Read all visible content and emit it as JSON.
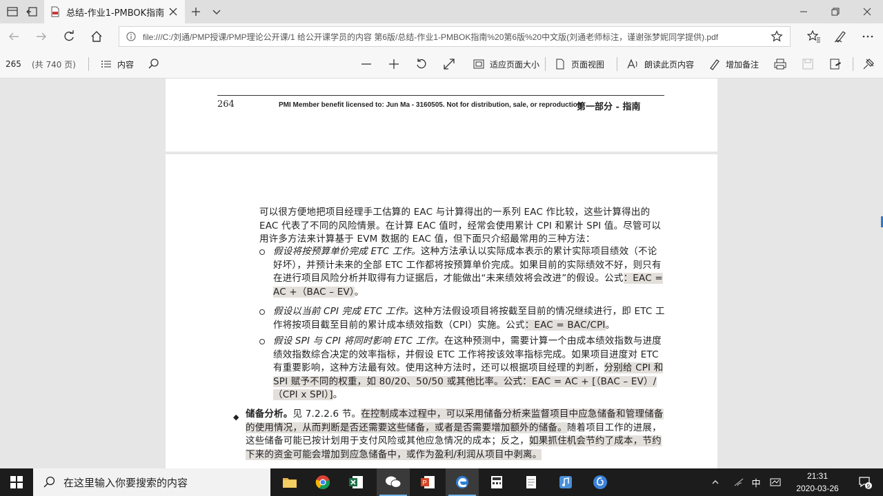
{
  "browser": {
    "tab_title": "总结-作业1-PMBOK指南",
    "url": "file:///C:/刘通/PMP授课/PMP理论公开课/1 给公开课学员的内容 第6版/总结-作业1-PMBOK指南%20第6版%20中文版(刘通老师标注，谨谢张梦妮同学提供).pdf"
  },
  "pdf_toolbar": {
    "current_page": "265",
    "total_pages": "(共 740 页)",
    "contents_label": "内容",
    "fit_page_label": "适应页面大小",
    "page_view_label": "页面视图",
    "read_aloud_label": "朗读此页内容",
    "add_note_label": "增加备注"
  },
  "document": {
    "page_number": "264",
    "license_text": "PMI Member benefit licensed to: Jun Ma - 3160505. Not for distribution, sale, or reproduction.",
    "part_title": "第一部分 - 指南",
    "para1": "可以很方便地把项目经理手工估算的 EAC 与计算得出的一系列 EAC 作比较，这些计算得出的 EAC 代表了不同的风险情景。在计算 EAC 值时，经常会使用累计 CPI 和累计 SPI 值。尽管可以用许多方法来计算基于 EVM 数据的 EAC 值，但下面只介绍最常用的三种方法：",
    "b1_italic": "假设将按预算单价完成 ETC 工作。",
    "b1_text": "这种方法承认以实际成本表示的累计实际项目绩效（不论好坏），并预计未来的全部 ETC 工作都将按预算单价完成。如果目前的实际绩效不好，则只有在进行项目风险分析并取得有力证据后，才能做出“未来绩效将会改进”的假设。公式",
    "b1_formula": "：EAC = AC +（BAC – EV）",
    "b1_end": "。",
    "b2_italic": "假设以当前 CPI 完成 ETC 工作。",
    "b2_text": "这种方法假设项目将按截至目前的情况继续进行，即 ETC 工作将按项目截至目前的累计成本绩效指数（CPI）实施。公式",
    "b2_formula": "：EAC = BAC/CPI",
    "b2_end": "。",
    "b3_italic": "假设 SPI 与 CPI 将同时影响 ETC 工作。",
    "b3_text": "在这种预测中，需要计算一个由成本绩效指数与进度绩效指数综合决定的效率指标，并假设 ETC 工作将按该效率指标完成。如果项目进度对 ETC 有重要影响，这种方法最有效。使用这种方法时，还可以根据项目经理的判断，",
    "b3_hl": "分别给 CPI 和 SPI 赋予不同的权重，如 80/20、50/50 或其他比率。公式：EAC = AC + [（BAC – EV）/（CPI x SPI）]",
    "b3_end": "。",
    "reserve_title": "储备分析。",
    "reserve_ref": "见 7.2.2.6 节。",
    "reserve_text1": "在控制成本过程中，可以采用储备分析来监督项目中应急储备和管理储备的使用情况，从而判断是否还需要这些储备，或者是否需要增加额外的储备。",
    "reserve_text2": "随着项目工作的进展，这些储备可能已按计划用于支付风险或其他应急情况的成本；反之，",
    "reserve_text3": "如果抓住机会节约了成本，节约下来的资金可能会增加到应急储备中，或作为盈利/利润从项目中剥离。"
  },
  "taskbar": {
    "search_placeholder": "在这里输入你要搜索的内容",
    "ime": "中",
    "time": "21:31",
    "date": "2020-03-26",
    "notification_count": "9"
  }
}
